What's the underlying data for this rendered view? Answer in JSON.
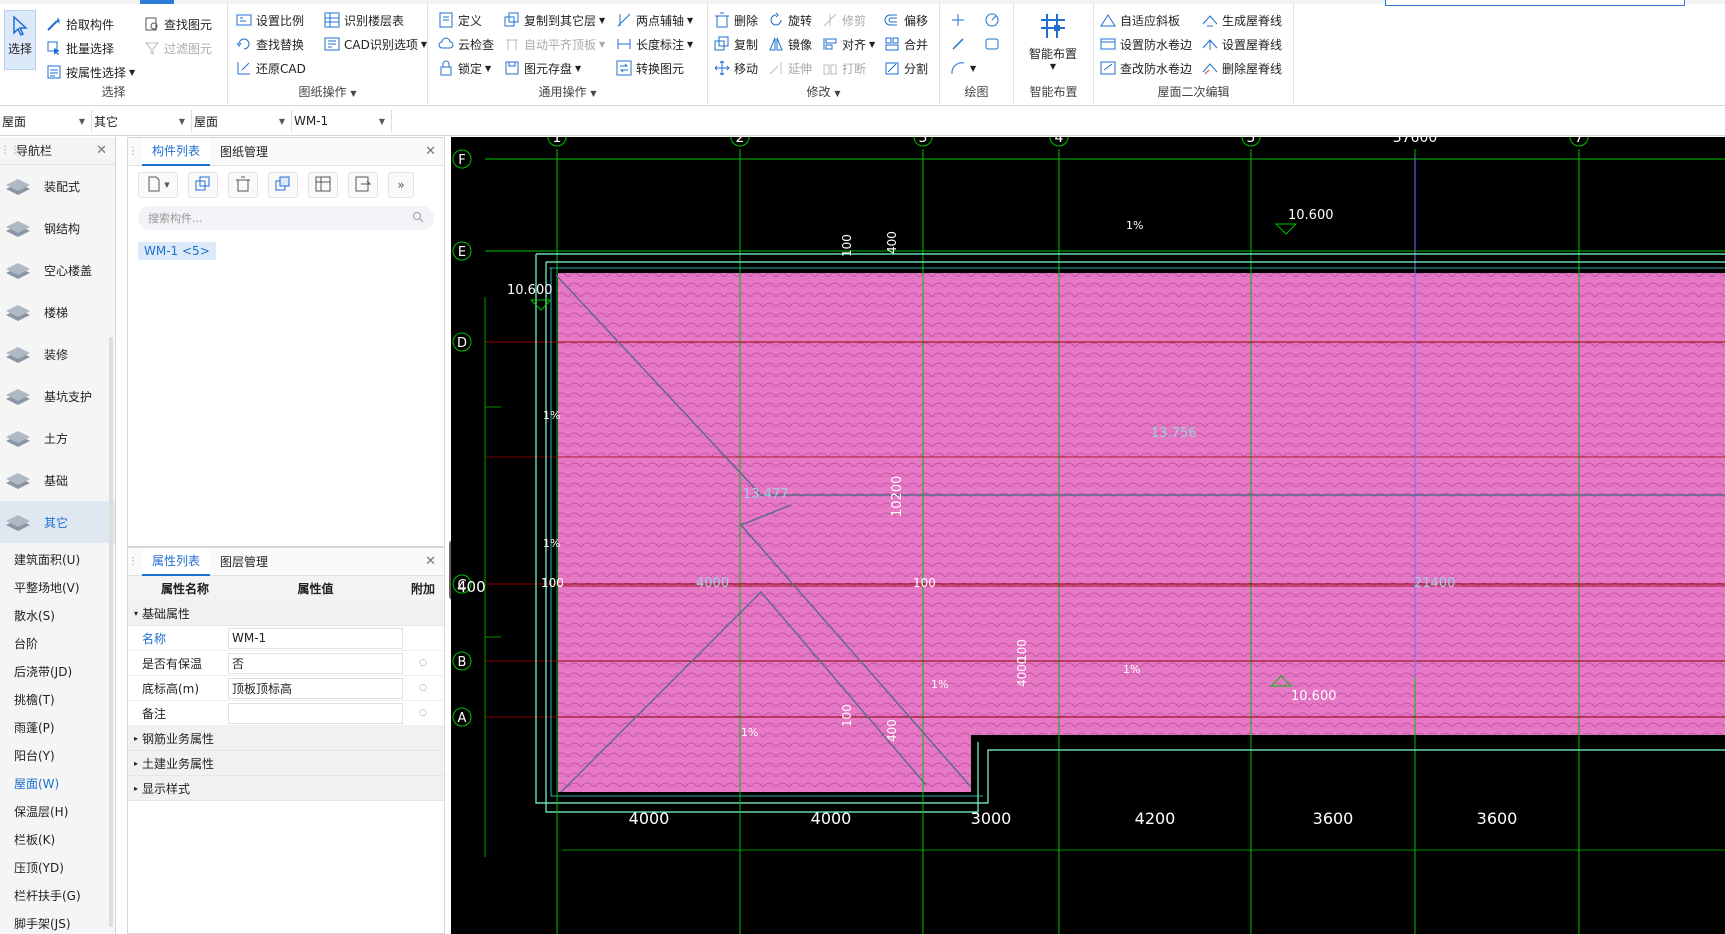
{
  "ribbon": {
    "select_group": {
      "title": "选择",
      "select_label": "选择",
      "pick": "拾取构件",
      "batch": "批量选择",
      "by_attr": "按属性选择",
      "find": "查找图元",
      "filter": "过滤图元"
    },
    "drawing_group": {
      "title": "图纸操作",
      "set_scale": "设置比例",
      "recognize_floor": "识别楼层表",
      "find_replace": "查找替换",
      "cad_options": "CAD识别选项",
      "restore_cad": "还原CAD"
    },
    "general_group": {
      "title": "通用操作",
      "define": "定义",
      "copy_other": "复制到其它层",
      "two_point_axis": "两点辅轴",
      "cloud_check": "云检查",
      "auto_flat": "自动平齐顶板",
      "length_dim": "长度标注",
      "lock": "锁定",
      "save_elem": "图元存盘",
      "convert": "转换图元"
    },
    "modify_group": {
      "title": "修改",
      "delete": "删除",
      "rotate": "旋转",
      "trim": "修剪",
      "offset": "偏移",
      "copy": "复制",
      "mirror": "镜像",
      "align": "对齐",
      "merge": "合并",
      "move": "移动",
      "extend": "延伸",
      "break": "打断",
      "split": "分割"
    },
    "draw_group": {
      "title": "绘图"
    },
    "smart_group": {
      "title": "智能布置",
      "label": "智能布置"
    },
    "roof_group": {
      "title": "屋面二次编辑",
      "adaptive_slope": "自适应斜板",
      "gen_ridge": "生成屋脊线",
      "set_waterproof": "设置防水卷边",
      "set_ridge": "设置屋脊线",
      "check_waterproof": "查改防水卷边",
      "del_ridge": "删除屋脊线"
    }
  },
  "selectors": [
    "屋面",
    "其它",
    "屋面",
    "WM-1"
  ],
  "nav": {
    "title": "导航栏",
    "categories": [
      "装配式",
      "钢结构",
      "空心楼盖",
      "楼梯",
      "装修",
      "基坑支护",
      "土方",
      "基础",
      "其它"
    ],
    "items": [
      "建筑面积(U)",
      "平整场地(V)",
      "散水(S)",
      "台阶",
      "后浇带(JD)",
      "挑檐(T)",
      "雨蓬(P)",
      "阳台(Y)",
      "屋面(W)",
      "保温层(H)",
      "栏板(K)",
      "压顶(YD)",
      "栏杆扶手(G)",
      "脚手架(JS)"
    ]
  },
  "component_panel": {
    "tab_list": "构件列表",
    "tab_drawing": "图纸管理",
    "search_placeholder": "搜索构件...",
    "component": "WM-1 <5>"
  },
  "property_panel": {
    "tab_attr": "属性列表",
    "tab_layer": "图层管理",
    "headers": [
      "属性名称",
      "属性值",
      "附加"
    ],
    "section_basic": "基础属性",
    "rows": [
      {
        "name": "名称",
        "value": "WM-1"
      },
      {
        "name": "是否有保温",
        "value": "否"
      },
      {
        "name": "底标高(m)",
        "value": "顶板顶标高"
      },
      {
        "name": "备注",
        "value": ""
      }
    ],
    "sections": [
      "钢筋业务属性",
      "土建业务属性",
      "显示样式"
    ]
  },
  "cad": {
    "axis_top": [
      "1",
      "2",
      "3",
      "4",
      "5",
      "37600",
      "7"
    ],
    "axis_left": [
      "F",
      "E",
      "D",
      "C",
      "B",
      "A"
    ],
    "dims_bottom": [
      "4000",
      "4000",
      "3000",
      "4200",
      "3600",
      "3600"
    ],
    "left_dim": "400",
    "labels": {
      "el1": "10.600",
      "el2": "10.600",
      "el3": "10.600",
      "el4": "13.756",
      "el5": "13.477",
      "slope": "1%",
      "d100": "100",
      "d400": "400",
      "d10200": "10200",
      "d21400": "21400",
      "d4000": "4000",
      "dot100": "100"
    }
  },
  "colors": {
    "accent": "#1f6fd1",
    "roof_fill": "#e778c6",
    "axis_line": "#00c000",
    "grid_red": "#a00000",
    "outline": "#7fffd4"
  }
}
